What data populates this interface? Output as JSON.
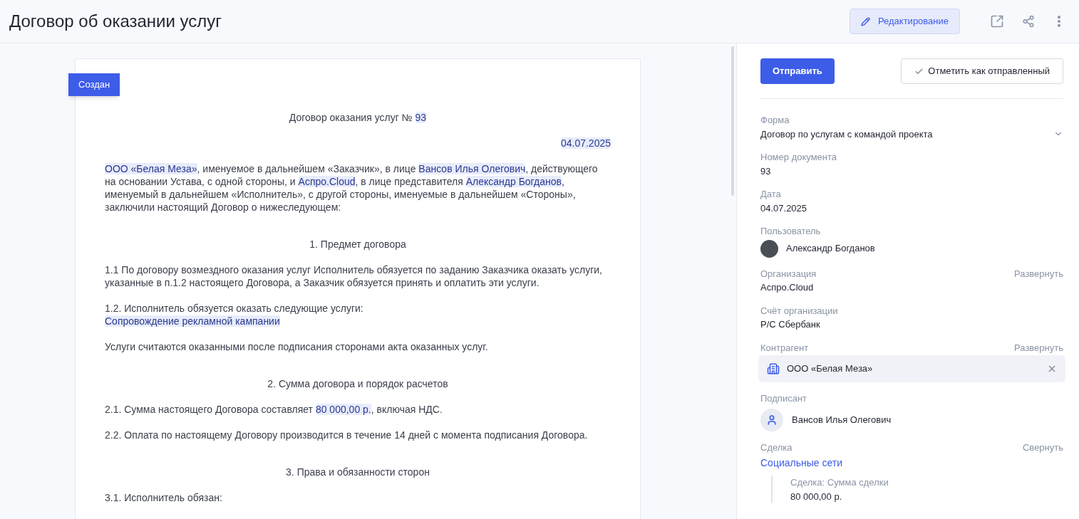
{
  "header": {
    "title": "Договор об оказании услуг",
    "edit_button": "Редактирование"
  },
  "document": {
    "status_badge": "Создан",
    "paragraphs": [
      {
        "kind": "heading",
        "segments": [
          {
            "text": "Договор оказания услуг № ",
            "field": false
          },
          {
            "text": "93",
            "field": true
          }
        ]
      },
      {
        "kind": "date",
        "segments": [
          {
            "text": "04.07.2025",
            "field": true
          }
        ]
      },
      {
        "kind": "para",
        "segments": [
          {
            "text": "ООО «Белая Меза»",
            "field": true
          },
          {
            "text": ", именуемое в дальнейшем «Заказчик», в лице ",
            "field": false
          },
          {
            "text": "Вансов Илья Олегович",
            "field": true
          },
          {
            "text": ", действующего на основании Устава, с одной стороны, и  ",
            "field": false
          },
          {
            "text": "Аспро.Cloud",
            "field": true
          },
          {
            "text": ", в лице представителя ",
            "field": false
          },
          {
            "text": "Александр Богданов",
            "field": true
          },
          {
            "text": ", именуемый в дальнейшем «Исполнитель», с другой стороны, именуемые в дальнейшем «Стороны», заключили настоящий Договор о нижеследующем:",
            "field": false
          }
        ]
      },
      {
        "kind": "heading",
        "segments": [
          {
            "text": "1. Предмет договора",
            "field": false
          }
        ]
      },
      {
        "kind": "para",
        "segments": [
          {
            "text": "1.1 По договору возмездного оказания услуг Исполнитель обязуется по заданию Заказчика оказать услуги, указанные в п.1.2 настоящего Договора, а Заказчик обязуется принять и оплатить эти услуги.",
            "field": false
          }
        ]
      },
      {
        "kind": "para",
        "segments": [
          {
            "text": "1.2. Исполнитель обязуется оказать следующие услуги:\n",
            "field": false
          },
          {
            "text": "Сопровождение рекламной кампании",
            "field": true
          }
        ]
      },
      {
        "kind": "para",
        "segments": [
          {
            "text": "Услуги считаются оказанными после подписания сторонами акта оказанных услуг.",
            "field": false
          }
        ]
      },
      {
        "kind": "heading",
        "segments": [
          {
            "text": "2. Сумма договора и порядок расчетов",
            "field": false
          }
        ]
      },
      {
        "kind": "para",
        "segments": [
          {
            "text": "2.1. Сумма настоящего Договора составляет ",
            "field": false
          },
          {
            "text": "80 000,00 р.",
            "field": true
          },
          {
            "text": ", включая НДС.",
            "field": false
          }
        ]
      },
      {
        "kind": "para",
        "segments": [
          {
            "text": "2.2. Оплата по настоящему Договору производится в течение 14 дней с момента подписания Договора.",
            "field": false
          }
        ]
      },
      {
        "kind": "heading",
        "segments": [
          {
            "text": "3. Права и обязанности сторон",
            "field": false
          }
        ]
      },
      {
        "kind": "para",
        "segments": [
          {
            "text": "3.1. Исполнитель обязан:",
            "field": false
          }
        ]
      }
    ]
  },
  "panel": {
    "send_button": "Отправить",
    "mark_sent_button": "Отметить как отправленный",
    "fields": [
      {
        "kind": "select",
        "label": "Форма",
        "value": "Договор по услугам с командой проекта"
      },
      {
        "kind": "text",
        "label": "Номер документа",
        "value": "93"
      },
      {
        "kind": "text",
        "label": "Дата",
        "value": "04.07.2025"
      },
      {
        "kind": "user",
        "label": "Пользователь",
        "value": "Александр Богданов"
      },
      {
        "kind": "text",
        "label": "Организация",
        "value": "Аспро.Cloud",
        "action": "Развернуть"
      },
      {
        "kind": "text",
        "label": "Счёт организации",
        "value": "Р/С Сбербанк"
      },
      {
        "kind": "company",
        "label": "Контрагент",
        "value": "ООО «Белая Меза»",
        "action": "Развернуть"
      },
      {
        "kind": "signer",
        "label": "Подписант",
        "value": "Вансов Илья Олегович"
      },
      {
        "kind": "link",
        "label": "Сделка",
        "value": "Социальные сети",
        "action": "Свернуть",
        "sub_label": "Сделка: Сумма сделки",
        "sub_value": "80 000,00 р."
      }
    ]
  }
}
